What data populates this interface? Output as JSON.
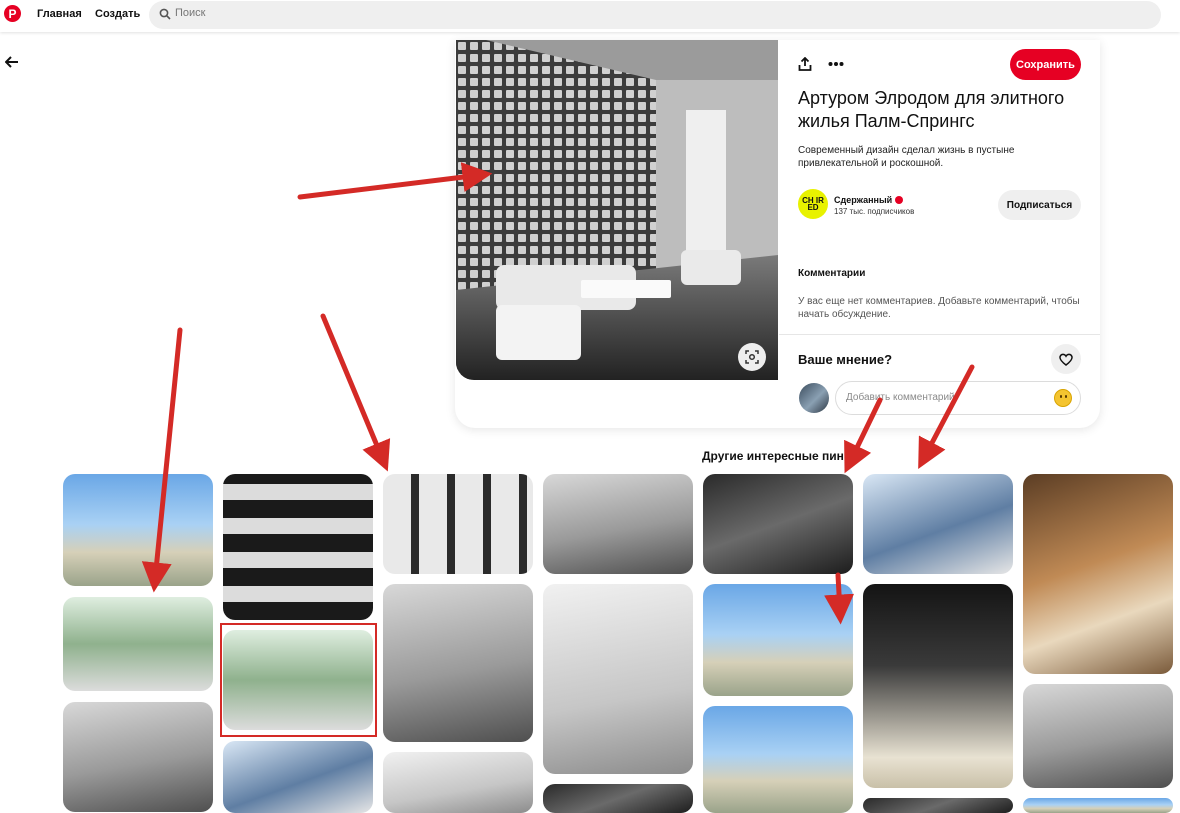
{
  "nav": {
    "home": "Главная",
    "create": "Создать",
    "search_placeholder": "Поиск"
  },
  "pin": {
    "save": "Сохранить",
    "title": "Артуром Элродом для элитного жилья Палм-Спрингс",
    "description": "Современный дизайн сделал жизнь в пустыне привлекательной и роскошной.",
    "channel": {
      "avatar_text": "CH IR ED",
      "name": "Сдержанный",
      "subscribers": "137 тыс. подписчиков",
      "subscribe": "Подписаться"
    },
    "comments_heading": "Комментарии",
    "comments_empty": "У вас еще нет комментариев. Добавьте комментарий, чтобы начать обсуждение.",
    "opinion": "Ваше мнение?",
    "comment_placeholder": "Добавить комментарий"
  },
  "more_heading": "Другие интересные пины",
  "colors": {
    "brand": "#e60023",
    "annotation": "#d42a26"
  },
  "icons": [
    "pinterest-logo-icon",
    "search-icon",
    "back-arrow-icon",
    "share-icon",
    "more-icon",
    "visual-search-icon",
    "verified-icon",
    "heart-icon",
    "emoji-icon"
  ]
}
